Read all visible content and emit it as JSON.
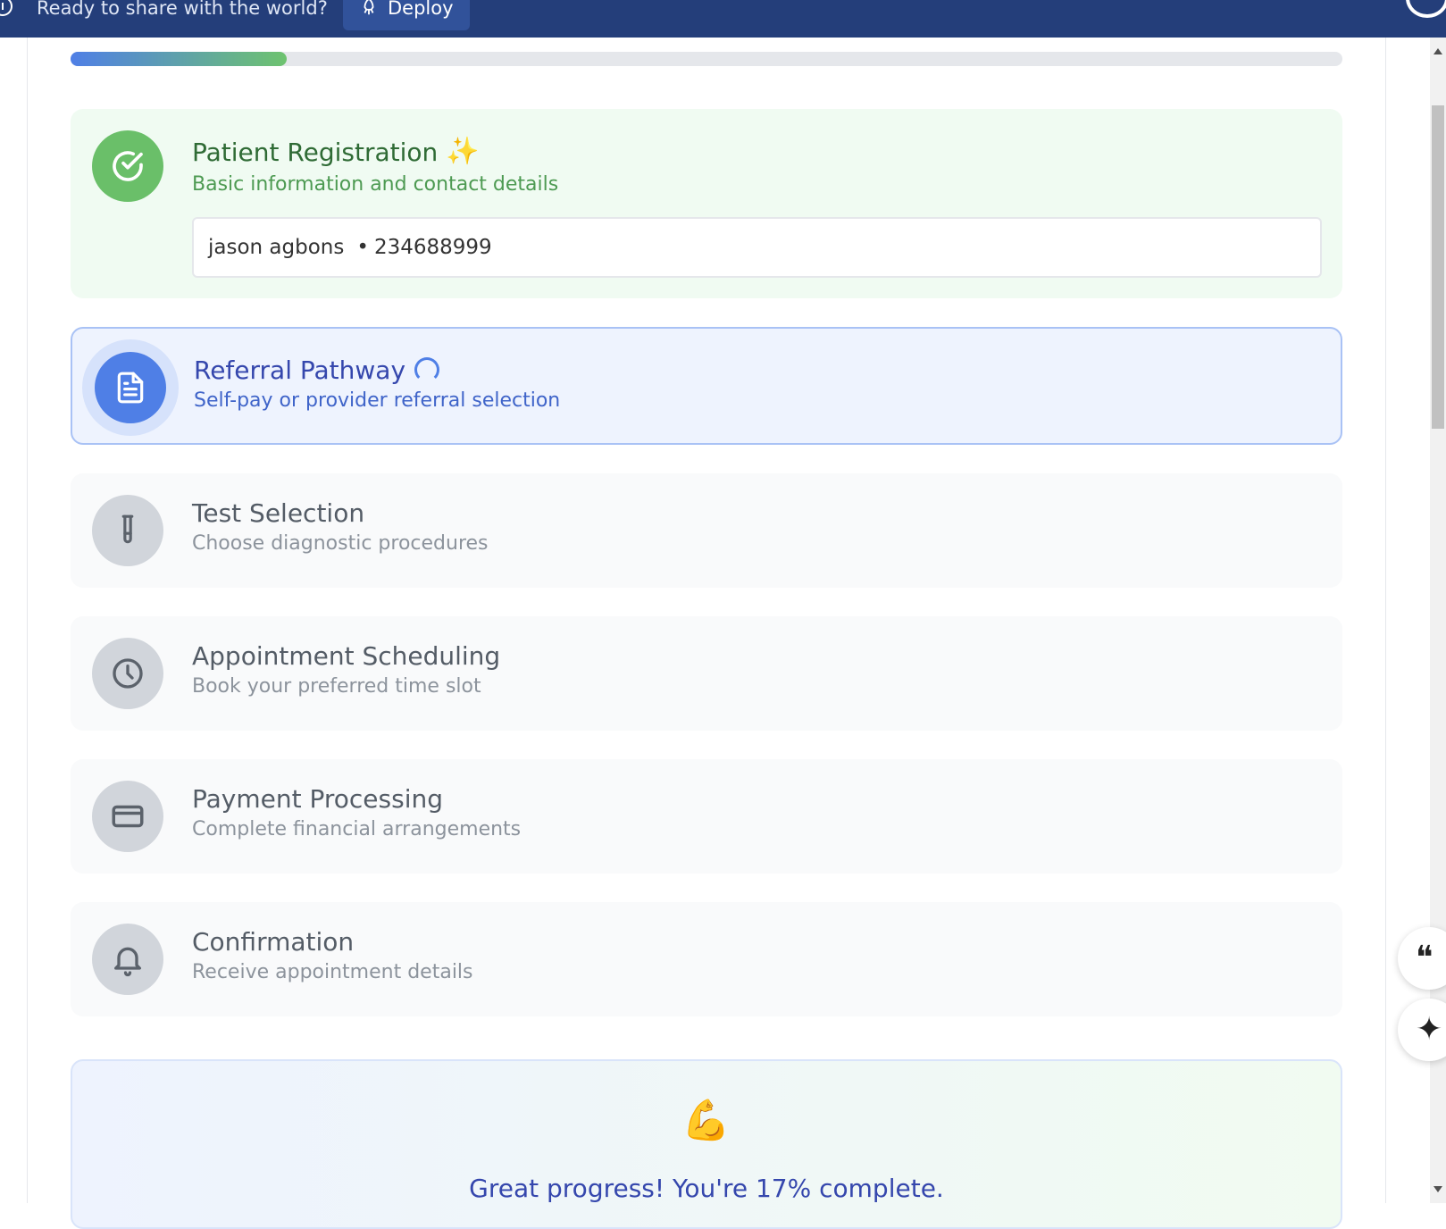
{
  "topbar": {
    "message": "Ready to share with the world?",
    "deploy_label": "Deploy",
    "info_icon": "info-icon",
    "deploy_icon": "rocket-icon"
  },
  "progress": {
    "percent": 17
  },
  "steps": [
    {
      "title": "Patient Registration",
      "subtitle": "Basic information and contact details",
      "status": "complete",
      "icon": "check-circle-icon",
      "summary": {
        "name": "jason agbons",
        "separator": "•",
        "phone": "234688999"
      }
    },
    {
      "title": "Referral Pathway",
      "subtitle": "Self-pay or provider referral selection",
      "status": "active",
      "icon": "document-icon"
    },
    {
      "title": "Test Selection",
      "subtitle": "Choose diagnostic procedures",
      "status": "pending",
      "icon": "test-tube-icon"
    },
    {
      "title": "Appointment Scheduling",
      "subtitle": "Book your preferred time slot",
      "status": "pending",
      "icon": "clock-icon"
    },
    {
      "title": "Payment Processing",
      "subtitle": "Complete financial arrangements",
      "status": "pending",
      "icon": "credit-card-icon"
    },
    {
      "title": "Confirmation",
      "subtitle": "Receive appointment details",
      "status": "pending",
      "icon": "bell-icon"
    }
  ],
  "encouragement": {
    "emoji": "💪",
    "message": "Great progress! You're 17% complete."
  },
  "colors": {
    "topbar": "#243e7a",
    "complete": "#6abf69",
    "active": "#4f7fe6",
    "pending": "#d1d5db"
  }
}
